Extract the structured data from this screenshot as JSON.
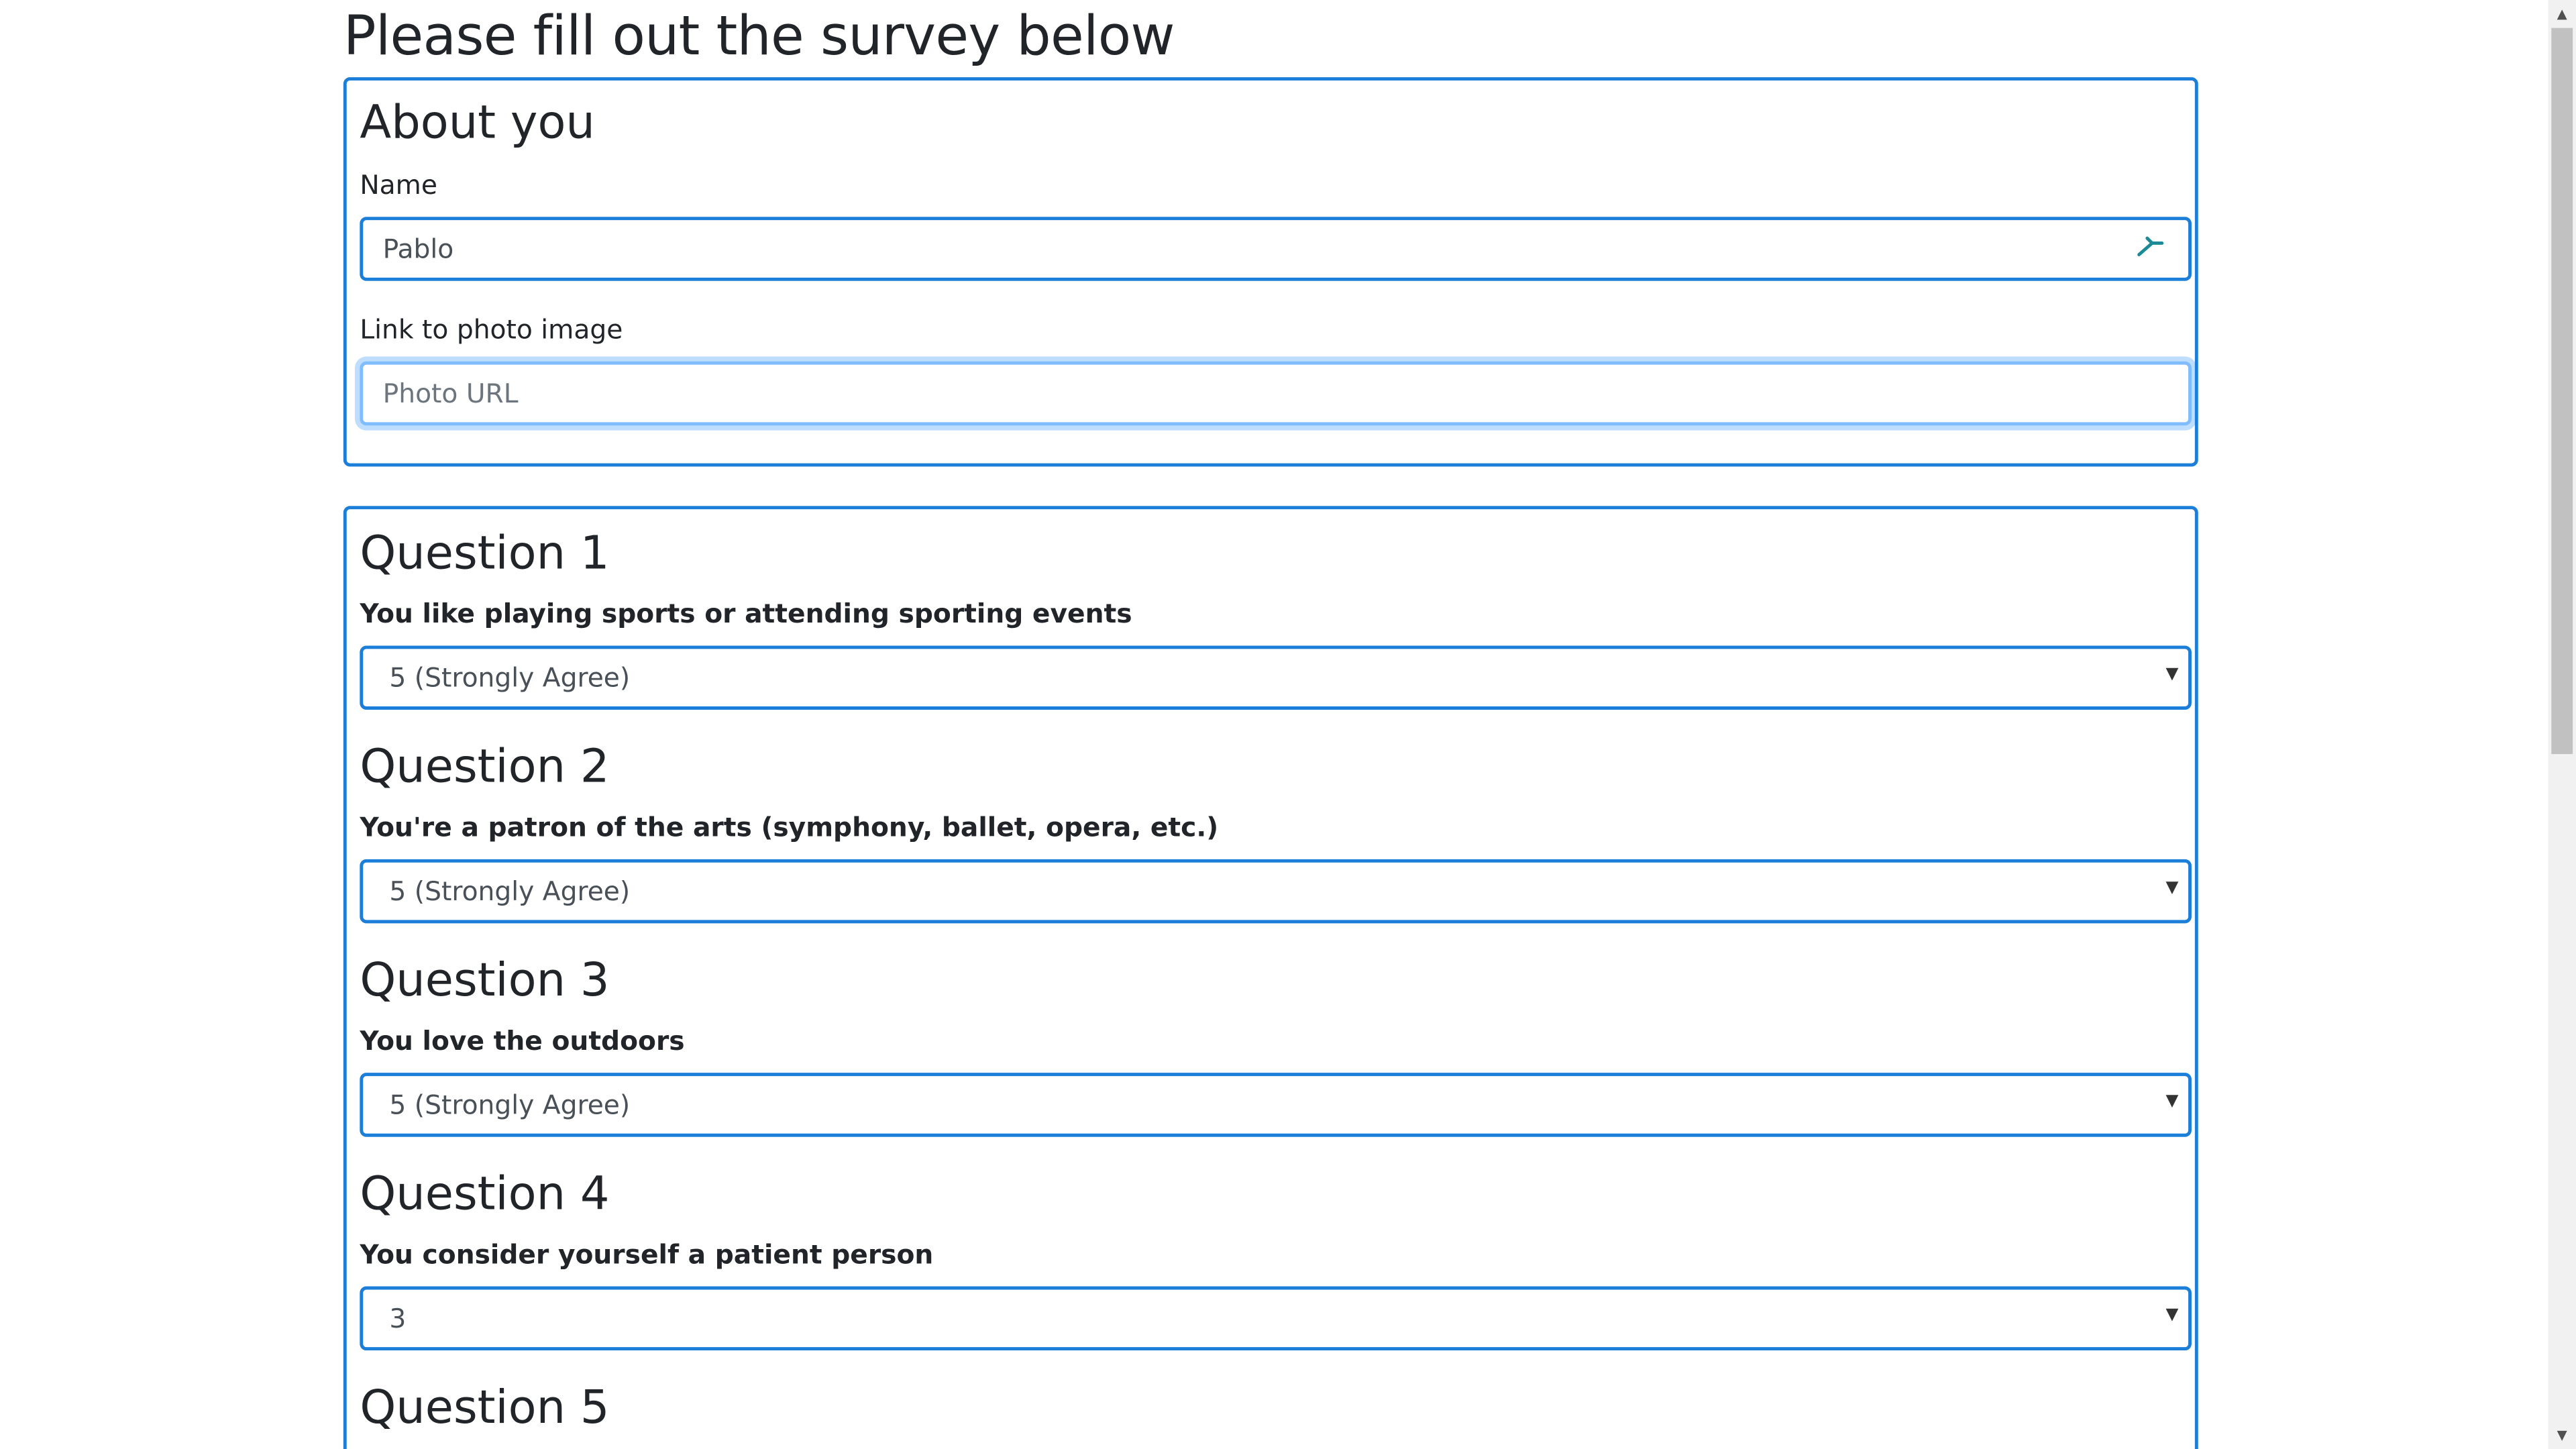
{
  "page": {
    "title": "Please fill out the survey below"
  },
  "about": {
    "title": "About you",
    "name_label": "Name",
    "name_value": "Pablo",
    "photo_label": "Link to photo image",
    "photo_placeholder": "Photo URL",
    "photo_value": ""
  },
  "questions": [
    {
      "title": "Question 1",
      "prompt": "You like playing sports or attending sporting events",
      "selected": "5 (Strongly Agree)"
    },
    {
      "title": "Question 2",
      "prompt": "You're a patron of the arts (symphony, ballet, opera, etc.)",
      "selected": "5 (Strongly Agree)"
    },
    {
      "title": "Question 3",
      "prompt": "You love the outdoors",
      "selected": "5 (Strongly Agree)"
    },
    {
      "title": "Question 4",
      "prompt": "You consider yourself a patient person",
      "selected": "3"
    },
    {
      "title": "Question 5"
    }
  ],
  "icons": {
    "autofill": "autofill-key-icon",
    "dropdown": "chevron-down-icon",
    "scroll_up": "scroll-up-arrow-icon",
    "scroll_down": "scroll-down-arrow-icon"
  },
  "colors": {
    "accent_border": "#1b7fd9",
    "focus_border": "#80bdff",
    "text": "#212529",
    "autofill_icon": "#1a8a96"
  }
}
